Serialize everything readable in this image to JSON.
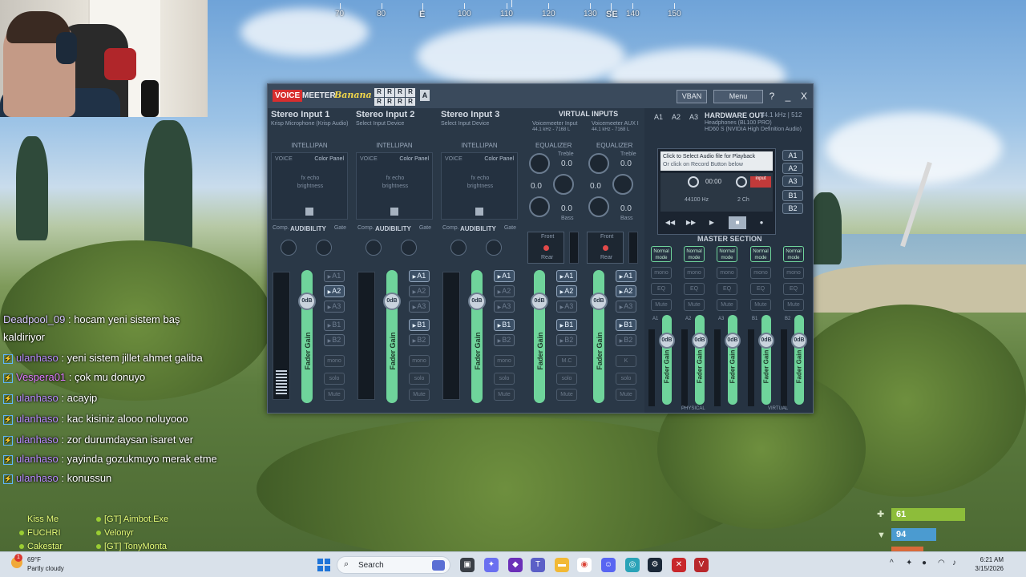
{
  "compass": {
    "labels": [
      "70",
      "80",
      "E",
      "100",
      "110",
      "120",
      "130",
      "SE",
      "140",
      "150"
    ]
  },
  "chat": {
    "messages": [
      {
        "user": "Deadpool_09",
        "text": "hocam yeni sistem baş kaldiriyor"
      },
      {
        "user": "ulanhaso",
        "text": "yeni sistem jillet ahmet galiba"
      },
      {
        "user": "Vespera01",
        "text": "çok mu donuyo"
      },
      {
        "user": "ulanhaso",
        "text": "acayip"
      },
      {
        "user": "ulanhaso",
        "text": "kac kisiniz alooo noluyooo"
      },
      {
        "user": "ulanhaso",
        "text": "zor durumdaysan isaret ver"
      },
      {
        "user": "ulanhaso",
        "text": "yayinda gozukmuyo merak etme"
      },
      {
        "user": "ulanhaso",
        "text": "konussun"
      }
    ],
    "overlay_team": [
      "Kiss Me",
      "[GT] Aimbot.Exe",
      "FUCHRI",
      "Velonyr",
      "Cakestar",
      "[GT] TonyMonta"
    ]
  },
  "hud": {
    "health": "61",
    "hydration": "94"
  },
  "voicemeeter": {
    "logo_voice": "VOICE",
    "logo_meeter": "MEETER",
    "logo_banana": "Banana",
    "r_grid": [
      "R",
      "R",
      "R",
      "R",
      "R",
      "R",
      "R",
      "R"
    ],
    "a_badge": "A",
    "vban": "VBAN",
    "menu": "Menu",
    "help": "?",
    "minimize": "_",
    "close": "X",
    "strips": [
      {
        "title": "Stereo Input 1",
        "device": "Krisp Microphone (Krisp Audio)"
      },
      {
        "title": "Stereo Input 2",
        "device": "Select Input Device"
      },
      {
        "title": "Stereo Input 3",
        "device": "Select Input Device"
      }
    ],
    "virtual_inputs": {
      "title": "VIRTUAL INPUTS",
      "vi1": "Voicemeeter Input",
      "vi1_rate": "44.1 kHz - 7168 L",
      "vi2": "Voicemeeter AUX I",
      "vi2_rate": "44.1 kHz - 7168 L"
    },
    "intellipan": "INTELLIPAN",
    "voice": "VOICE",
    "color_panel": "Color Panel",
    "fx_echo": "fx echo",
    "brightness": "brightness",
    "comp": "Comp.",
    "audibility": "AUDIBILITY",
    "gate": "Gate",
    "equalizer": "EQUALIZER",
    "treble": "Treble",
    "bass": "Bass",
    "eq_values": [
      "0.0",
      "0.0",
      "0.0",
      "0.0",
      "0.0",
      "0.0",
      "0.0",
      "0.0"
    ],
    "front": "Front",
    "rear": "Rear",
    "fader_gain": "Fader Gain",
    "db": "0dB",
    "bus_buttons": [
      "A1",
      "A2",
      "A3",
      "B1",
      "B2"
    ],
    "mono": "mono",
    "solo": "solo",
    "mute": "Mute",
    "mc": "M.C",
    "k": "K",
    "hardware_out": {
      "tabs": [
        "A1",
        "A2",
        "A3"
      ],
      "title": "HARDWARE OUT",
      "rate": "44.1 kHz | 512",
      "device1": "Headphones (BL100 PRO)",
      "device2": "HD60 S (NVIDIA High Definition Audio)"
    },
    "player": {
      "msg1": "Click to Select Audio file for Playback",
      "msg2": "Or click on Record Button below",
      "time": "00:00",
      "input": "input",
      "rate": "44100 Hz",
      "channels": "2 Ch",
      "rec_buttons": [
        "A1",
        "A2",
        "A3",
        "B1",
        "B2"
      ]
    },
    "master_section": "MASTER SECTION",
    "normal_mode": "Normal mode",
    "eq": "EQ",
    "physical": "PHYSICAL",
    "virtual": "VIRTUAL",
    "master_bus_labels": [
      "A1",
      "A2",
      "A3",
      "B1",
      "B2"
    ]
  },
  "taskbar": {
    "temp": "69°F",
    "weather": "Partly cloudy",
    "weather_badge": "1",
    "search": "Search",
    "time": "6:21 AM",
    "date": "3/15/2026"
  }
}
